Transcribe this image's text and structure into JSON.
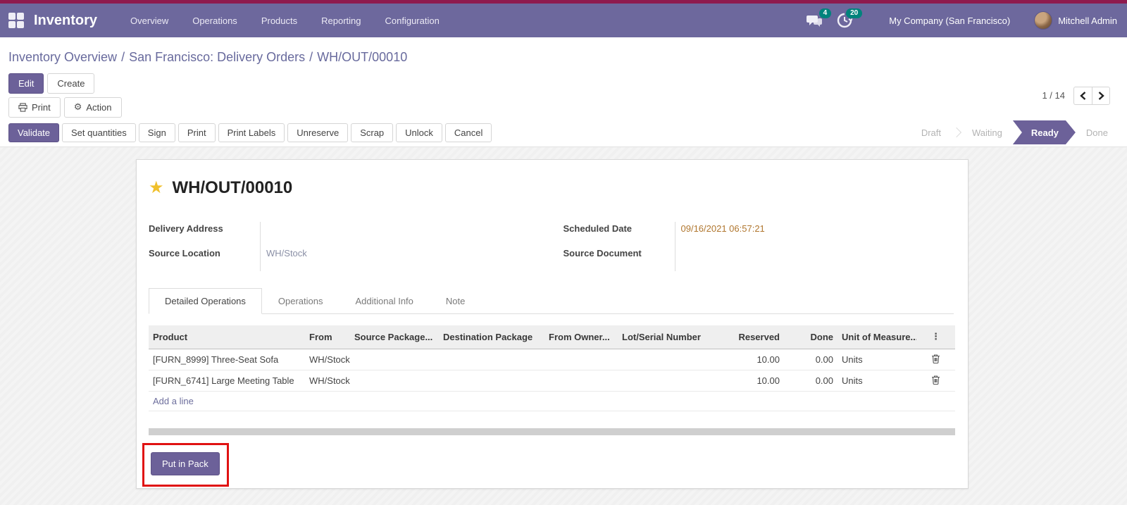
{
  "topbar": {
    "app_name": "Inventory",
    "menus": [
      "Overview",
      "Operations",
      "Products",
      "Reporting",
      "Configuration"
    ],
    "messages_badge": "4",
    "activities_badge": "20",
    "company": "My Company (San Francisco)",
    "user": "Mitchell Admin"
  },
  "breadcrumb": {
    "separator": "/",
    "items": [
      "Inventory Overview",
      "San Francisco: Delivery Orders",
      "WH/OUT/00010"
    ]
  },
  "control_panel": {
    "edit_label": "Edit",
    "create_label": "Create",
    "print_label": "Print",
    "action_label": "Action",
    "pager_value": "1 / 14"
  },
  "statusbar": {
    "buttons": [
      "Validate",
      "Set quantities",
      "Sign",
      "Print",
      "Print Labels",
      "Unreserve",
      "Scrap",
      "Unlock",
      "Cancel"
    ],
    "states": [
      "Draft",
      "Waiting",
      "Ready",
      "Done"
    ],
    "active_state": "Ready"
  },
  "document": {
    "title": "WH/OUT/00010",
    "fields": {
      "delivery_address_label": "Delivery Address",
      "delivery_address_value": "",
      "source_location_label": "Source Location",
      "source_location_value": "WH/Stock",
      "scheduled_date_label": "Scheduled Date",
      "scheduled_date_value": "09/16/2021 06:57:21",
      "source_document_label": "Source Document",
      "source_document_value": ""
    },
    "tabs": [
      "Detailed Operations",
      "Operations",
      "Additional Info",
      "Note"
    ],
    "active_tab": "Detailed Operations",
    "table": {
      "columns": [
        "Product",
        "From",
        "Source Package...",
        "Destination Package",
        "From Owner...",
        "Lot/Serial Number",
        "Reserved",
        "Done",
        "Unit of Measure..."
      ],
      "highlighted_column": "Destination Package",
      "options_icon": "⋮",
      "rows": [
        {
          "product": "[FURN_8999] Three-Seat Sofa",
          "from": "WH/Stock",
          "source_package": "",
          "destination_package": "",
          "from_owner": "",
          "lot_serial": "",
          "reserved": "10.00",
          "done": "0.00",
          "uom": "Units"
        },
        {
          "product": "[FURN_6741] Large Meeting Table",
          "from": "WH/Stock",
          "source_package": "",
          "destination_package": "",
          "from_owner": "",
          "lot_serial": "",
          "reserved": "10.00",
          "done": "0.00",
          "uom": "Units"
        }
      ],
      "add_line_label": "Add a line"
    },
    "put_in_pack_label": "Put in Pack"
  },
  "icons": {
    "star": "★",
    "gear": "⚙"
  },
  "colors": {
    "navbar": "#6d689d",
    "top_line": "#8e1a4e",
    "primary_button": "#6c6199",
    "badge": "#00837c",
    "annotation": "#e01212",
    "date_text": "#b0762e",
    "star": "#f0c02c"
  }
}
